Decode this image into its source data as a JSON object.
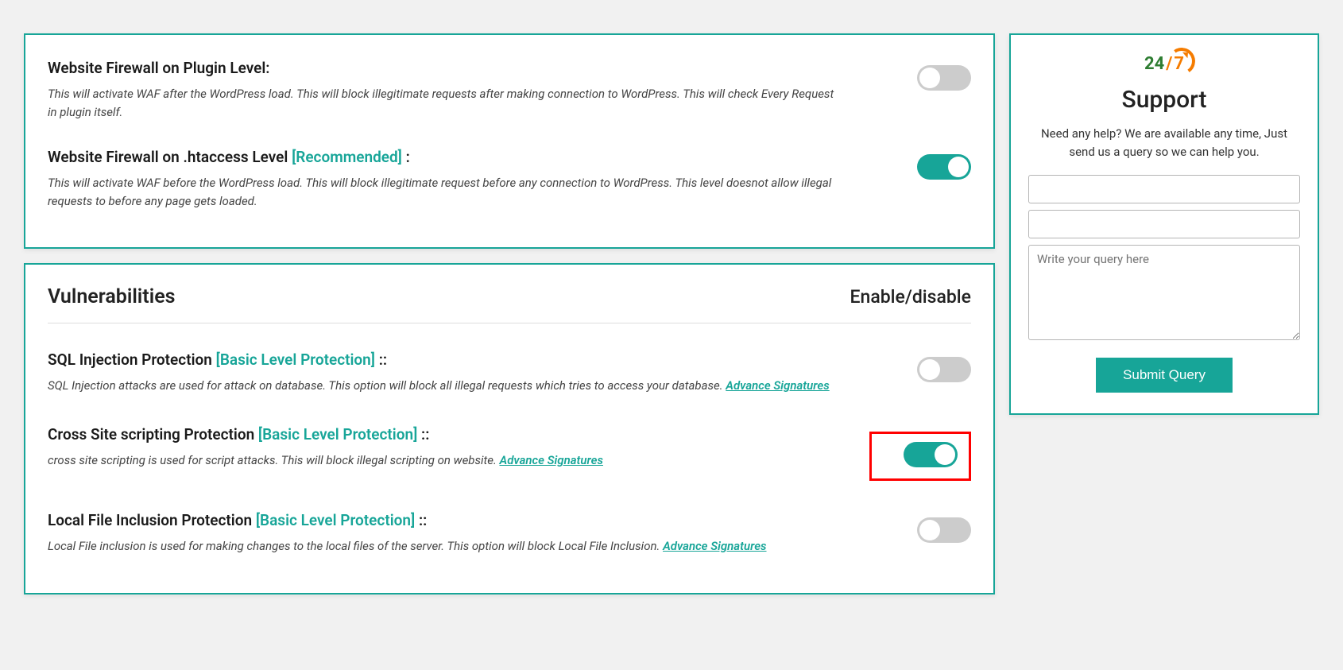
{
  "panels": {
    "firewall": {
      "plugin": {
        "title_pre": "Website Firewall on Plugin Level:",
        "tag": "",
        "title_post": "",
        "desc": "This will activate WAF after the WordPress load. This will block illegitimate requests after making connection to WordPress. This will check Every Request in plugin itself.",
        "adv_link": "",
        "enabled": false,
        "highlight": false
      },
      "htaccess": {
        "title_pre": "Website Firewall on .htaccess Level ",
        "tag": "[Recommended]",
        "title_post": " :",
        "desc": "This will activate WAF before the WordPress load. This will block illegitimate request before any connection to WordPress. This level doesnot allow illegal requests to before any page gets loaded.",
        "adv_link": "",
        "enabled": true,
        "highlight": false
      }
    },
    "vuln": {
      "header_left": "Vulnerabilities",
      "header_right": "Enable/disable",
      "sql": {
        "title_pre": "SQL Injection Protection ",
        "tag": "[Basic Level Protection]",
        "title_post": " ::",
        "desc": "SQL Injection attacks are used for attack on database. This option will block all illegal requests which tries to access your database. ",
        "adv_link": "Advance Signatures",
        "enabled": false,
        "highlight": false
      },
      "xss": {
        "title_pre": "Cross Site scripting Protection ",
        "tag": "[Basic Level Protection]",
        "title_post": " ::",
        "desc": "cross site scripting is used for script attacks. This will block illegal scripting on website. ",
        "adv_link": "Advance Signatures",
        "enabled": true,
        "highlight": true
      },
      "lfi": {
        "title_pre": "Local File Inclusion Protection ",
        "tag": "[Basic Level Protection]",
        "title_post": " ::",
        "desc": "Local File inclusion is used for making changes to the local files of the server. This option will block Local File Inclusion. ",
        "adv_link": "Advance Signatures",
        "enabled": false,
        "highlight": false
      }
    }
  },
  "sidebar": {
    "icon": {
      "n24": "24",
      "slash": "/",
      "n7": "7"
    },
    "title": "Support",
    "subtitle": "Need any help? We are available any time, Just send us a query so we can help you.",
    "field1_value": "",
    "field2_value": "",
    "query_placeholder": "Write your query here",
    "query_value": "",
    "submit_label": "Submit Query"
  }
}
